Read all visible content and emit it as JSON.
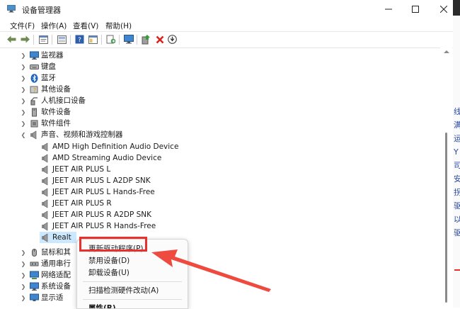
{
  "window": {
    "title": "设备管理器",
    "controls": [
      "minimize",
      "maximize",
      "close"
    ]
  },
  "menubar": [
    "文件(F)",
    "操作(A)",
    "查看(V)",
    "帮助(H)"
  ],
  "toolbar": [
    "back-icon",
    "forward-icon",
    "properties-icon",
    "show-hide-console-tree-icon",
    "help-icon",
    "console-tree-icon",
    "export-list-icon",
    "monitor-icon",
    "update-driver-icon",
    "uninstall-icon",
    "scan-hardware-icon"
  ],
  "tree": {
    "categories": [
      {
        "label": "监视器",
        "icon": "monitor-icon",
        "expanded": false
      },
      {
        "label": "键盘",
        "icon": "keyboard-icon",
        "expanded": false
      },
      {
        "label": "蓝牙",
        "icon": "bluetooth-icon",
        "expanded": false
      },
      {
        "label": "其他设备",
        "icon": "unknown-device-icon",
        "expanded": false
      },
      {
        "label": "人机接口设备",
        "icon": "hid-icon",
        "expanded": false
      },
      {
        "label": "软件设备",
        "icon": "software-device-icon",
        "expanded": false
      },
      {
        "label": "软件组件",
        "icon": "software-component-icon",
        "expanded": false
      },
      {
        "label": "声音、视频和游戏控制器",
        "icon": "speaker-icon",
        "expanded": true
      }
    ],
    "audio_devices": [
      "AMD High Definition Audio Device",
      "AMD Streaming Audio Device",
      "JEET AIR PLUS L",
      "JEET AIR PLUS L A2DP SNK",
      "JEET AIR PLUS L Hands-Free",
      "JEET AIR PLUS R",
      "JEET AIR PLUS R A2DP SNK",
      "JEET AIR PLUS R Hands-Free",
      "Realt"
    ],
    "categories_below": [
      {
        "label": "鼠标和其",
        "icon": "mouse-icon"
      },
      {
        "label": "通用串行",
        "icon": "usb-icon"
      },
      {
        "label": "网络适配",
        "icon": "network-icon"
      },
      {
        "label": "系统设备",
        "icon": "system-device-icon"
      },
      {
        "label": "显示适",
        "icon": "display-adapter-icon"
      }
    ]
  },
  "context_menu": {
    "items": [
      "更新驱动程序(P)",
      "禁用设备(D)",
      "卸载设备(U)",
      "扫描检测硬件改动(A)",
      "属性(R)"
    ],
    "highlighted": "更新驱动程序(P)"
  },
  "right_edge_text": [
    "线",
    "满",
    "运",
    "Y",
    "司",
    "安",
    "拐",
    "驱",
    "以",
    "驱"
  ],
  "colors": {
    "annotation_red": "#e8302d",
    "menu_bg": "#fbfbfb",
    "selection_bg": "#cce8ff",
    "right_edge_blue": "#2b4a9f"
  }
}
